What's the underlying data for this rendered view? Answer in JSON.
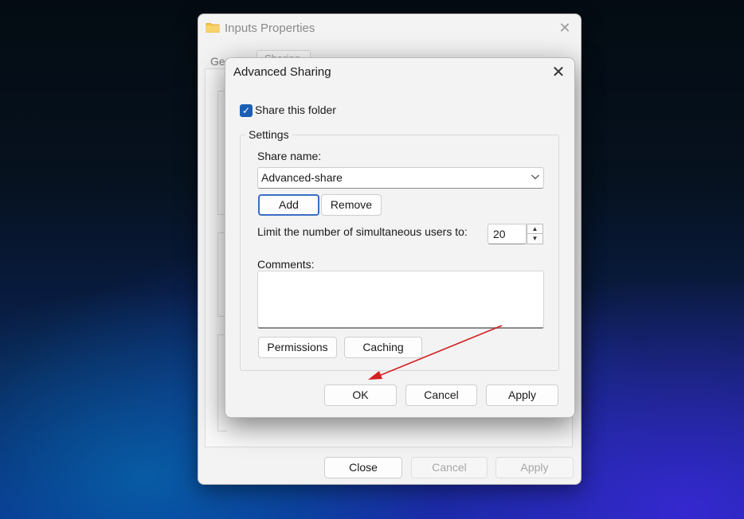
{
  "background_window": {
    "title": "Inputs Properties",
    "tabs": [
      "General",
      "Sharing"
    ],
    "buttons": {
      "close": "Close",
      "cancel": "Cancel",
      "apply": "Apply"
    }
  },
  "dialog": {
    "title": "Advanced Sharing",
    "share_checkbox": {
      "label": "Share this folder",
      "checked": true
    },
    "settings_legend": "Settings",
    "share_name_label": "Share name:",
    "share_name_value": "Advanced-share",
    "add_button": "Add",
    "remove_button": "Remove",
    "limit_label": "Limit the number of simultaneous users to:",
    "limit_value": "20",
    "comments_label": "Comments:",
    "comments_value": "",
    "permissions_button": "Permissions",
    "caching_button": "Caching",
    "ok_button": "OK",
    "cancel_button": "Cancel",
    "apply_button": "Apply"
  },
  "icons": {
    "folder": "folder-icon",
    "close": "close-icon",
    "dropdown": "chevron-down-icon",
    "check": "checkmark-icon",
    "spin_up": "spin-up-icon",
    "spin_down": "spin-down-icon",
    "annotation_arrow": "red-arrow-annotation"
  },
  "colors": {
    "accent": "#1b5fb5",
    "focus_border": "#3a6fc4",
    "annotation": "#d42020"
  }
}
